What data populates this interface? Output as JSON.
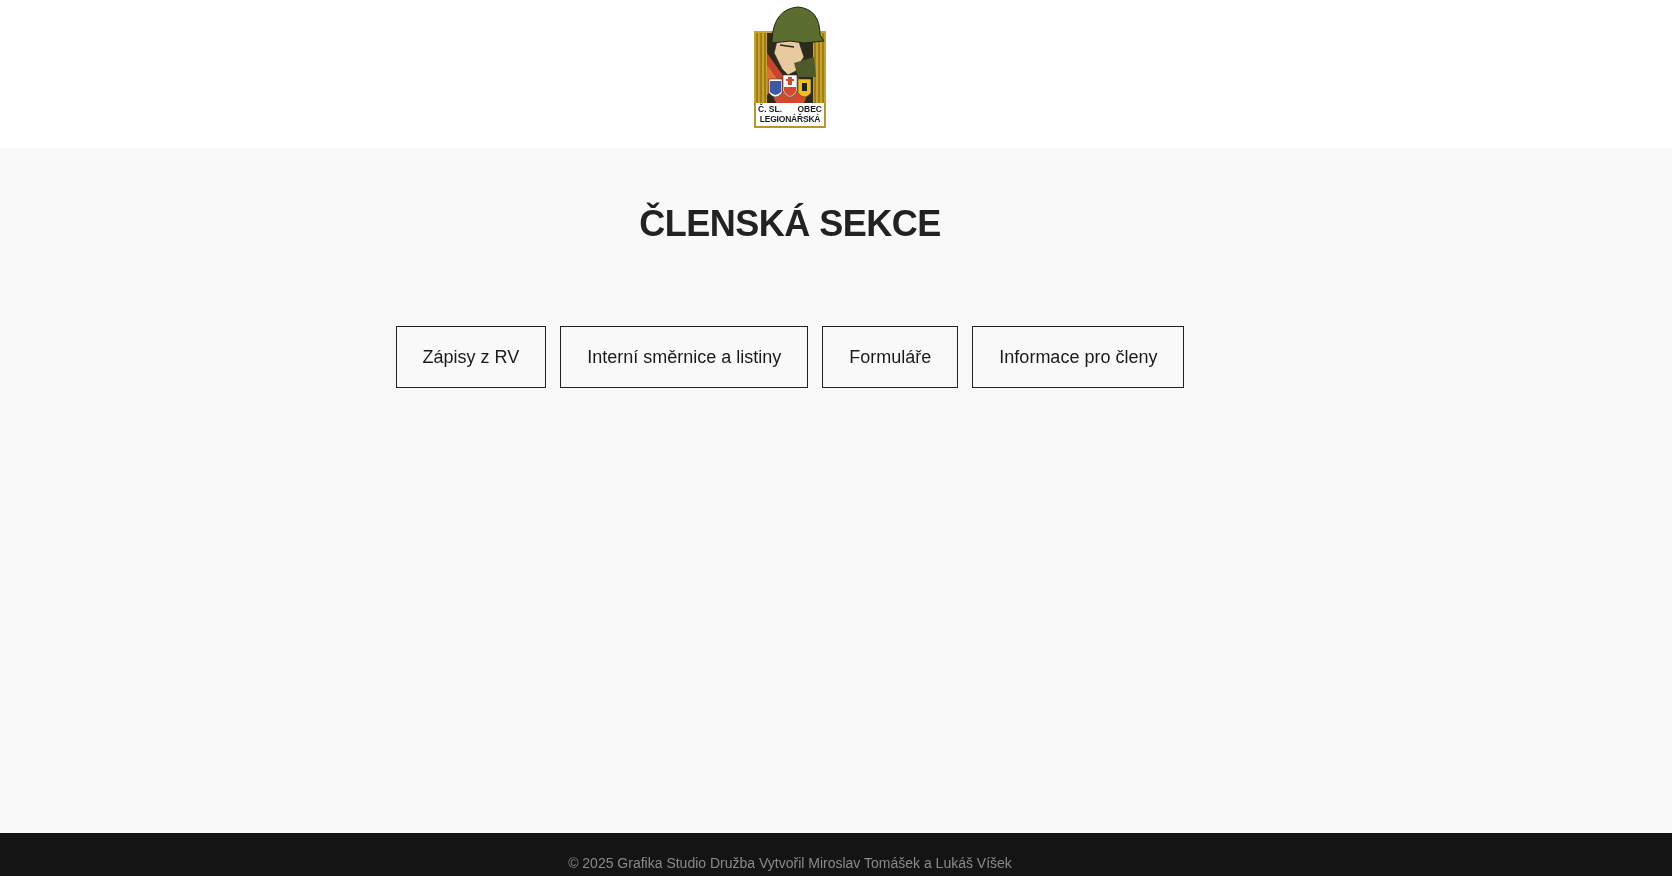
{
  "header": {
    "logo": {
      "line_1_left": "Č. SL.",
      "line_1_right": "OBEC",
      "line_2": "LEGIONÁŘSKÁ"
    }
  },
  "main": {
    "title": "ČLENSKÁ SEKCE",
    "buttons": [
      "Zápisy z RV",
      "Interní směrnice a listiny",
      "Formuláře",
      "Informace pro členy"
    ]
  },
  "footer": {
    "text": "© 2025 Grafika Studio Družba Vytvořil Miroslav Tomášek a Lukáš Víšek"
  }
}
